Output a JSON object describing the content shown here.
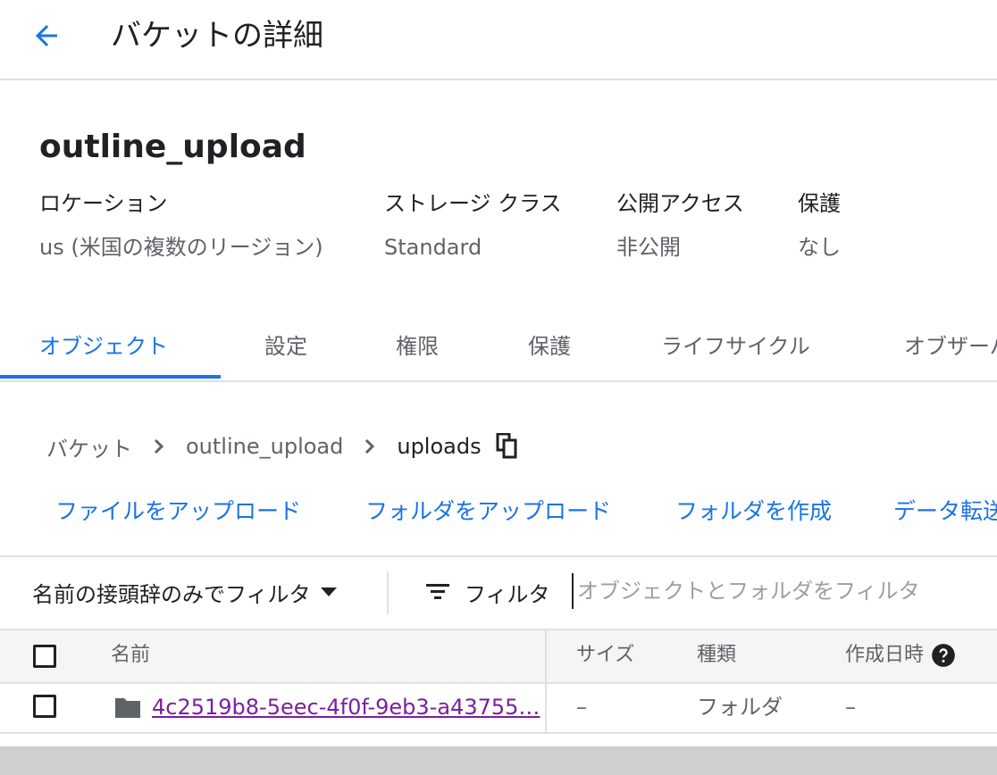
{
  "header": {
    "title": "バケットの詳細"
  },
  "bucket": {
    "name": "outline_upload",
    "meta": [
      {
        "label": "ロケーション",
        "value": "us (米国の複数のリージョン)"
      },
      {
        "label": "ストレージ クラス",
        "value": "Standard"
      },
      {
        "label": "公開アクセス",
        "value": "非公開"
      },
      {
        "label": "保護",
        "value": "なし"
      }
    ]
  },
  "tabs": [
    {
      "label": "オブジェクト",
      "active": true
    },
    {
      "label": "設定"
    },
    {
      "label": "権限"
    },
    {
      "label": "保護"
    },
    {
      "label": "ライフサイクル"
    },
    {
      "label": "オブザーバビリティ"
    }
  ],
  "breadcrumb": [
    "バケット",
    "outline_upload",
    "uploads"
  ],
  "actions": [
    "ファイルをアップロード",
    "フォルダをアップロード",
    "フォルダを作成",
    "データ転送"
  ],
  "filter": {
    "type_label": "名前の接頭辞のみでフィルタ",
    "button_label": "フィルタ",
    "placeholder": "オブジェクトとフォルダをフィルタ"
  },
  "table": {
    "columns": [
      "名前",
      "サイズ",
      "種類",
      "作成日時"
    ],
    "rows": [
      {
        "name": "4c2519b8-5eec-4f0f-9eb3-a43755…",
        "size": "–",
        "type": "フォルダ",
        "created": "–"
      }
    ]
  },
  "colors": {
    "accent": "#1a73e8",
    "link_visited": "#7b1fa2",
    "text": "#202124",
    "muted": "#5f6368",
    "divider": "#e0e0e0"
  }
}
